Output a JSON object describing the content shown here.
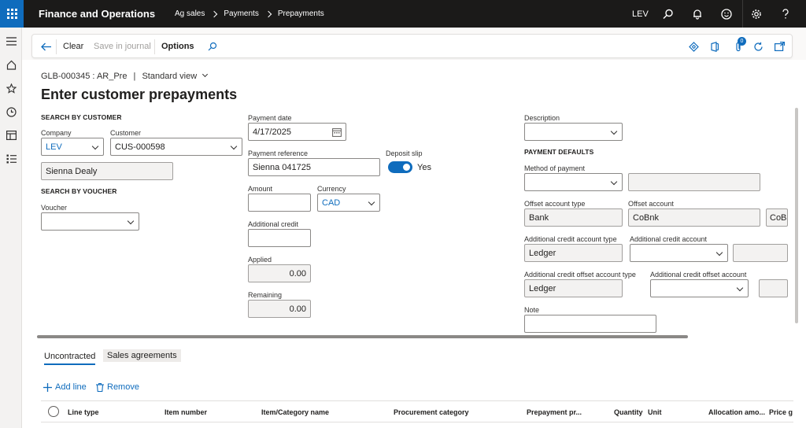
{
  "topbar": {
    "app_title": "Finance and Operations",
    "breadcrumbs": [
      "Ag sales",
      "Payments",
      "Prepayments"
    ],
    "company": "LEV"
  },
  "actions": {
    "clear": "Clear",
    "save_in_journal": "Save in journal",
    "options": "Options",
    "attachments_count": "0"
  },
  "header": {
    "record": "GLB-000345 : AR_Pre",
    "separator": "|",
    "view": "Standard view",
    "title": "Enter customer prepayments"
  },
  "search_customer": {
    "heading": "SEARCH BY CUSTOMER",
    "company_label": "Company",
    "company_value": "LEV",
    "customer_label": "Customer",
    "customer_value": "CUS-000598",
    "customer_name": "Sienna Dealy"
  },
  "search_voucher": {
    "heading": "SEARCH BY VOUCHER",
    "voucher_label": "Voucher",
    "voucher_value": ""
  },
  "payment": {
    "date_label": "Payment date",
    "date_value": "4/17/2025",
    "reference_label": "Payment reference",
    "reference_value": "Sienna 041725",
    "deposit_slip_label": "Deposit slip",
    "deposit_slip_value": "Yes",
    "amount_label": "Amount",
    "amount_value": "",
    "currency_label": "Currency",
    "currency_value": "CAD",
    "additional_credit_label": "Additional credit",
    "additional_credit_value": "",
    "applied_label": "Applied",
    "applied_value": "0.00",
    "remaining_label": "Remaining",
    "remaining_value": "0.00"
  },
  "defaults": {
    "description_label": "Description",
    "description_value": "",
    "heading": "PAYMENT DEFAULTS",
    "method_label": "Method of payment",
    "method_value": "",
    "offset_type_label": "Offset account type",
    "offset_type_value": "Bank",
    "offset_account_label": "Offset account",
    "offset_account_value": "CoBnk",
    "offset_account_extra": "CoBa",
    "add_credit_type_label": "Additional credit account type",
    "add_credit_type_value": "Ledger",
    "add_credit_account_label": "Additional credit account",
    "add_credit_account_value": "",
    "add_credit_offset_type_label": "Additional credit offset account type",
    "add_credit_offset_type_value": "Ledger",
    "add_credit_offset_account_label": "Additional credit offset account",
    "add_credit_offset_account_value": "",
    "note_label": "Note",
    "note_value": ""
  },
  "tabs": {
    "uncontracted": "Uncontracted",
    "sales_agreements": "Sales agreements"
  },
  "lines_toolbar": {
    "add_line": "Add line",
    "remove": "Remove"
  },
  "grid": {
    "columns": [
      "Line type",
      "Item number",
      "Item/Category name",
      "Procurement category",
      "Prepayment pr...",
      "Quantity",
      "Unit",
      "Allocation amo...",
      "Price g"
    ]
  },
  "colors": {
    "accent": "#0f6cbd",
    "topbar": "#1b1a19"
  }
}
